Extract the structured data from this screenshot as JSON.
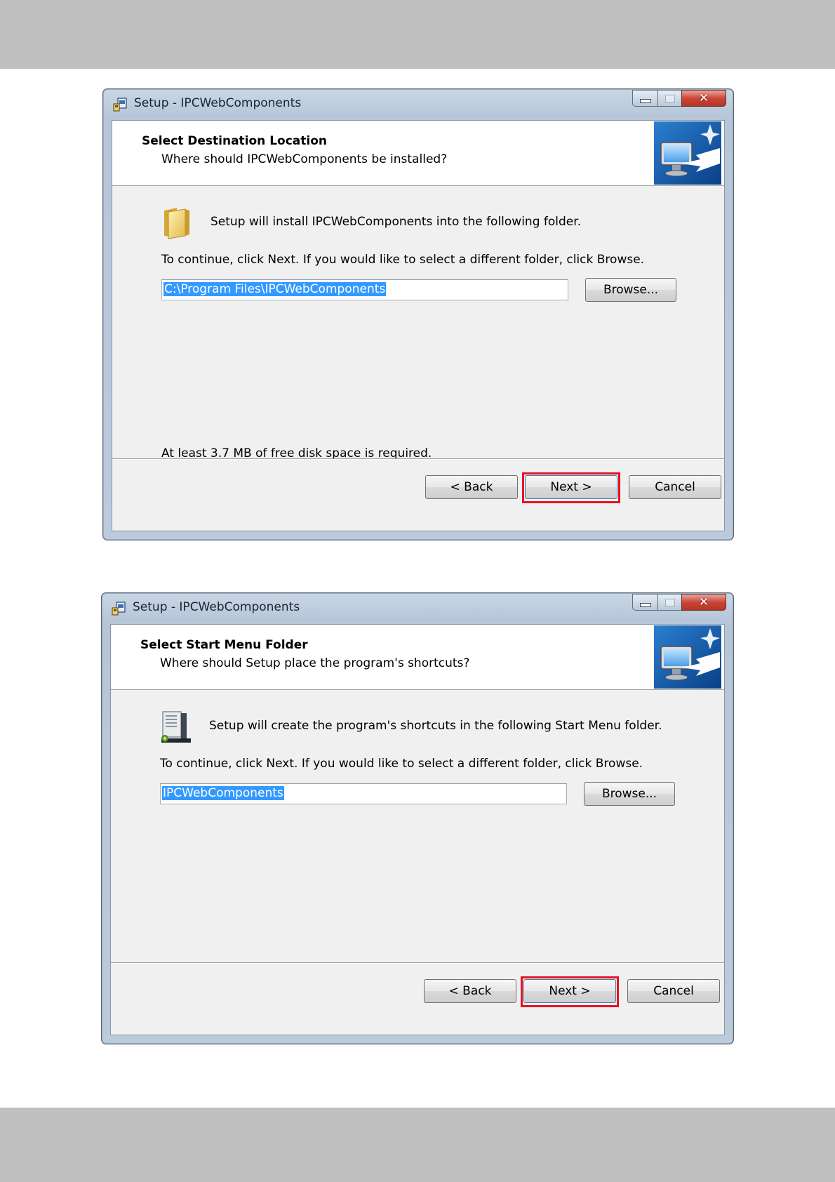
{
  "page": {
    "band_color": "#c0c0c0"
  },
  "dialogs": [
    {
      "window_title": "Setup - IPCWebComponents",
      "header_title": "Select Destination Location",
      "header_subtitle": "Where should IPCWebComponents be installed?",
      "body_icon": "folder-icon",
      "intro_text": "Setup will install IPCWebComponents into the following folder.",
      "continue_text": "To continue, click Next. If you would like to select a different folder, click Browse.",
      "path_value": "C:\\Program Files\\IPCWebComponents",
      "browse_label": "Browse...",
      "space_text": "At least 3.7 MB of free disk space is required.",
      "back_label": "< Back",
      "next_label": "Next >",
      "cancel_label": "Cancel",
      "highlight_color": "#e8121e"
    },
    {
      "window_title": "Setup - IPCWebComponents",
      "header_title": "Select Start Menu Folder",
      "header_subtitle": "Where should Setup place the program's shortcuts?",
      "body_icon": "start-menu-folder-icon",
      "intro_text": "Setup will create the program's shortcuts in the following Start Menu folder.",
      "continue_text": "To continue, click Next. If you would like to select a different folder, click Browse.",
      "path_value": "IPCWebComponents",
      "browse_label": "Browse...",
      "back_label": "< Back",
      "next_label": "Next >",
      "cancel_label": "Cancel",
      "highlight_color": "#e8121e"
    }
  ]
}
